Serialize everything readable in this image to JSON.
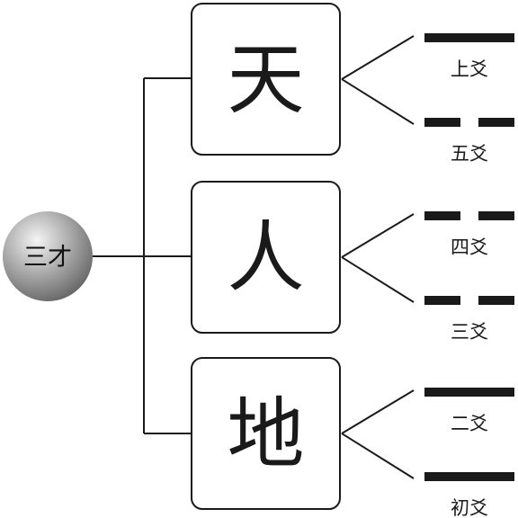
{
  "root": {
    "label": "三才"
  },
  "powers": [
    {
      "glyph": "天",
      "yao": [
        {
          "label": "上爻",
          "line": "solid"
        },
        {
          "label": "五爻",
          "line": "broken"
        }
      ]
    },
    {
      "glyph": "人",
      "yao": [
        {
          "label": "四爻",
          "line": "broken"
        },
        {
          "label": "三爻",
          "line": "broken"
        }
      ]
    },
    {
      "glyph": "地",
      "yao": [
        {
          "label": "二爻",
          "line": "solid"
        },
        {
          "label": "初爻",
          "line": "solid"
        }
      ]
    }
  ],
  "colors": {
    "ink": "#1a1a1a",
    "sphere_light": "#f4f4f4",
    "sphere_dark": "#6a6a6a"
  }
}
